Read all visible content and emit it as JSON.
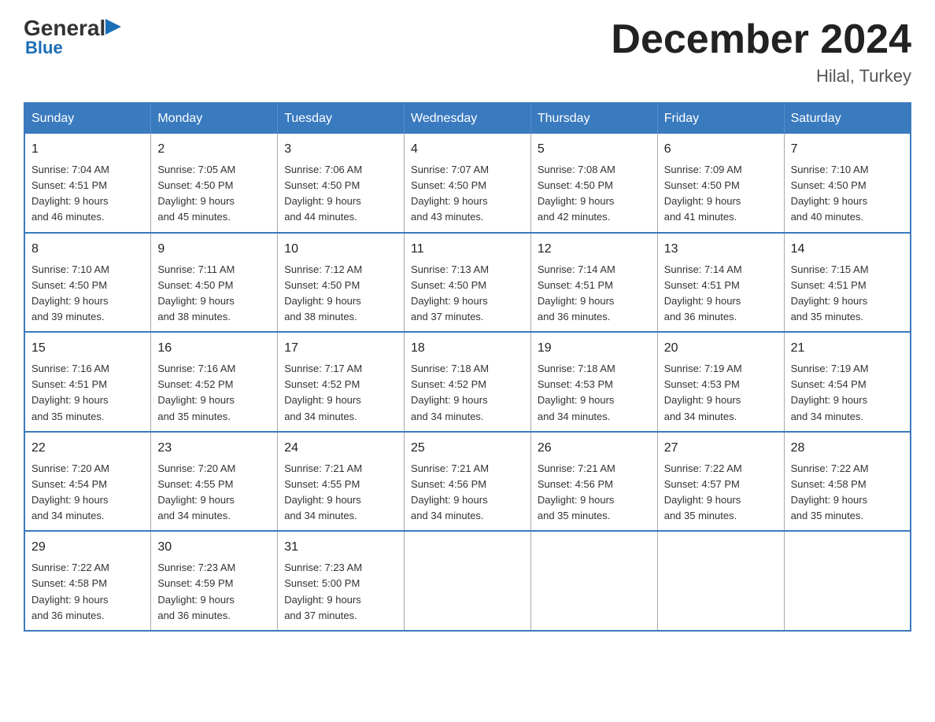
{
  "header": {
    "logo": {
      "general": "General",
      "blue": "Blue",
      "tagline": "Blue"
    },
    "title": "December 2024",
    "subtitle": "Hilal, Turkey"
  },
  "days_of_week": [
    "Sunday",
    "Monday",
    "Tuesday",
    "Wednesday",
    "Thursday",
    "Friday",
    "Saturday"
  ],
  "weeks": [
    [
      {
        "day": "1",
        "sunrise": "7:04 AM",
        "sunset": "4:51 PM",
        "daylight": "9 hours and 46 minutes."
      },
      {
        "day": "2",
        "sunrise": "7:05 AM",
        "sunset": "4:50 PM",
        "daylight": "9 hours and 45 minutes."
      },
      {
        "day": "3",
        "sunrise": "7:06 AM",
        "sunset": "4:50 PM",
        "daylight": "9 hours and 44 minutes."
      },
      {
        "day": "4",
        "sunrise": "7:07 AM",
        "sunset": "4:50 PM",
        "daylight": "9 hours and 43 minutes."
      },
      {
        "day": "5",
        "sunrise": "7:08 AM",
        "sunset": "4:50 PM",
        "daylight": "9 hours and 42 minutes."
      },
      {
        "day": "6",
        "sunrise": "7:09 AM",
        "sunset": "4:50 PM",
        "daylight": "9 hours and 41 minutes."
      },
      {
        "day": "7",
        "sunrise": "7:10 AM",
        "sunset": "4:50 PM",
        "daylight": "9 hours and 40 minutes."
      }
    ],
    [
      {
        "day": "8",
        "sunrise": "7:10 AM",
        "sunset": "4:50 PM",
        "daylight": "9 hours and 39 minutes."
      },
      {
        "day": "9",
        "sunrise": "7:11 AM",
        "sunset": "4:50 PM",
        "daylight": "9 hours and 38 minutes."
      },
      {
        "day": "10",
        "sunrise": "7:12 AM",
        "sunset": "4:50 PM",
        "daylight": "9 hours and 38 minutes."
      },
      {
        "day": "11",
        "sunrise": "7:13 AM",
        "sunset": "4:50 PM",
        "daylight": "9 hours and 37 minutes."
      },
      {
        "day": "12",
        "sunrise": "7:14 AM",
        "sunset": "4:51 PM",
        "daylight": "9 hours and 36 minutes."
      },
      {
        "day": "13",
        "sunrise": "7:14 AM",
        "sunset": "4:51 PM",
        "daylight": "9 hours and 36 minutes."
      },
      {
        "day": "14",
        "sunrise": "7:15 AM",
        "sunset": "4:51 PM",
        "daylight": "9 hours and 35 minutes."
      }
    ],
    [
      {
        "day": "15",
        "sunrise": "7:16 AM",
        "sunset": "4:51 PM",
        "daylight": "9 hours and 35 minutes."
      },
      {
        "day": "16",
        "sunrise": "7:16 AM",
        "sunset": "4:52 PM",
        "daylight": "9 hours and 35 minutes."
      },
      {
        "day": "17",
        "sunrise": "7:17 AM",
        "sunset": "4:52 PM",
        "daylight": "9 hours and 34 minutes."
      },
      {
        "day": "18",
        "sunrise": "7:18 AM",
        "sunset": "4:52 PM",
        "daylight": "9 hours and 34 minutes."
      },
      {
        "day": "19",
        "sunrise": "7:18 AM",
        "sunset": "4:53 PM",
        "daylight": "9 hours and 34 minutes."
      },
      {
        "day": "20",
        "sunrise": "7:19 AM",
        "sunset": "4:53 PM",
        "daylight": "9 hours and 34 minutes."
      },
      {
        "day": "21",
        "sunrise": "7:19 AM",
        "sunset": "4:54 PM",
        "daylight": "9 hours and 34 minutes."
      }
    ],
    [
      {
        "day": "22",
        "sunrise": "7:20 AM",
        "sunset": "4:54 PM",
        "daylight": "9 hours and 34 minutes."
      },
      {
        "day": "23",
        "sunrise": "7:20 AM",
        "sunset": "4:55 PM",
        "daylight": "9 hours and 34 minutes."
      },
      {
        "day": "24",
        "sunrise": "7:21 AM",
        "sunset": "4:55 PM",
        "daylight": "9 hours and 34 minutes."
      },
      {
        "day": "25",
        "sunrise": "7:21 AM",
        "sunset": "4:56 PM",
        "daylight": "9 hours and 34 minutes."
      },
      {
        "day": "26",
        "sunrise": "7:21 AM",
        "sunset": "4:56 PM",
        "daylight": "9 hours and 35 minutes."
      },
      {
        "day": "27",
        "sunrise": "7:22 AM",
        "sunset": "4:57 PM",
        "daylight": "9 hours and 35 minutes."
      },
      {
        "day": "28",
        "sunrise": "7:22 AM",
        "sunset": "4:58 PM",
        "daylight": "9 hours and 35 minutes."
      }
    ],
    [
      {
        "day": "29",
        "sunrise": "7:22 AM",
        "sunset": "4:58 PM",
        "daylight": "9 hours and 36 minutes."
      },
      {
        "day": "30",
        "sunrise": "7:23 AM",
        "sunset": "4:59 PM",
        "daylight": "9 hours and 36 minutes."
      },
      {
        "day": "31",
        "sunrise": "7:23 AM",
        "sunset": "5:00 PM",
        "daylight": "9 hours and 37 minutes."
      },
      null,
      null,
      null,
      null
    ]
  ],
  "labels": {
    "sunrise": "Sunrise:",
    "sunset": "Sunset:",
    "daylight": "Daylight:"
  }
}
